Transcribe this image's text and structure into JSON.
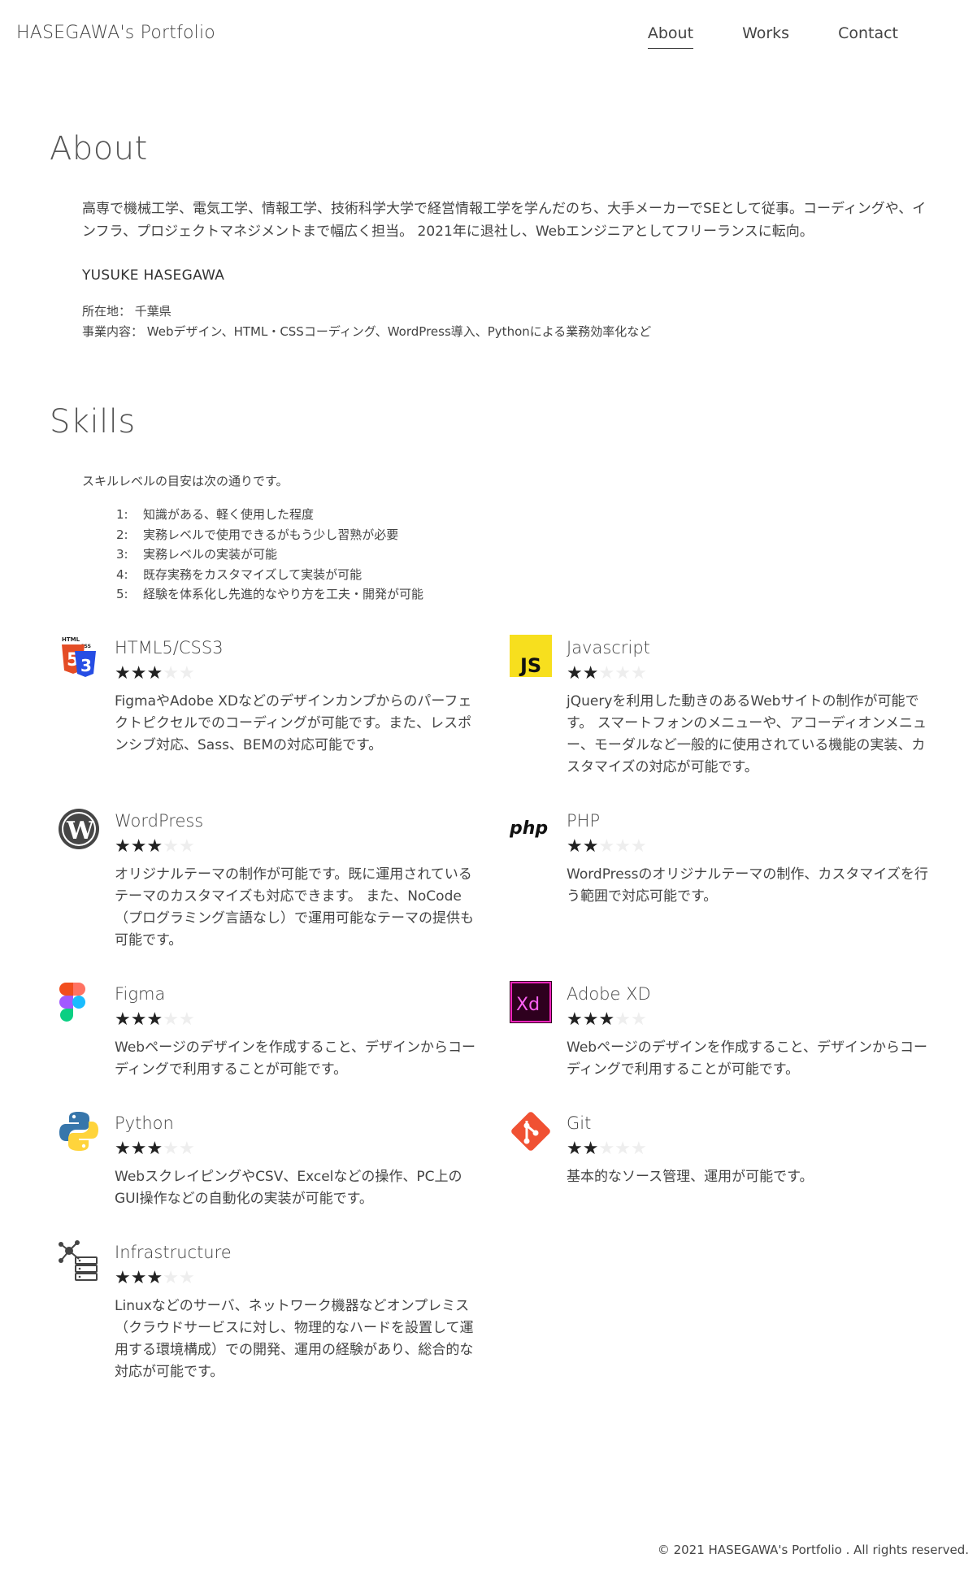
{
  "header": {
    "site_title": "HASEGAWA's Portfolio",
    "nav": [
      "About",
      "Works",
      "Contact"
    ]
  },
  "about": {
    "title": "About",
    "text": "高専で機械工学、電気工学、情報工学、技術科学大学で経営情報工学を学んだのち、大手メーカーでSEとして従事。コーディングや、インフラ、プロジェクトマネジメントまで幅広く担当。 2021年に退社し、Webエンジニアとしてフリーランスに転向。",
    "name": "YUSUKE HASEGAWA",
    "location": "所在地： 千葉県",
    "business": "事業内容： Webデザイン、HTML・CSSコーディング、WordPress導入、Pythonによる業務効率化など"
  },
  "skills": {
    "title": "Skills",
    "intro": "スキルレベルの目安は次の通りです。",
    "levels": [
      {
        "num": "1:",
        "text": "知識がある、軽く使用した程度"
      },
      {
        "num": "2:",
        "text": "実務レベルで使用できるがもう少し習熟が必要"
      },
      {
        "num": "3:",
        "text": "実務レベルの実装が可能"
      },
      {
        "num": "4:",
        "text": "既存実務をカスタマイズして実装が可能"
      },
      {
        "num": "5:",
        "text": "経験を体系化し先進的なやり方を工夫・開発が可能"
      }
    ],
    "items": [
      {
        "name": "HTML5/CSS3",
        "rating": 3,
        "icon": "html5-css3-icon",
        "desc": "FigmaやAdobe XDなどのデザインカンプからのパーフェクトピクセルでのコーディングが可能です。また、レスポンシブ対応、Sass、BEMの対応可能です。"
      },
      {
        "name": "Javascript",
        "rating": 2,
        "icon": "javascript-icon",
        "desc": "jQueryを利用した動きのあるWebサイトの制作が可能です。 スマートフォンのメニューや、アコーディオンメニュー、モーダルなど一般的に使用されている機能の実装、カスタマイズの対応が可能です。"
      },
      {
        "name": "WordPress",
        "rating": 3,
        "icon": "wordpress-icon",
        "desc": "オリジナルテーマの制作が可能です。既に運用されているテーマのカスタマイズも対応できます。 また、NoCode（プログラミング言語なし）で運用可能なテーマの提供も可能です。"
      },
      {
        "name": "PHP",
        "rating": 2,
        "icon": "php-icon",
        "desc": "WordPressのオリジナルテーマの制作、カスタマイズを行う範囲で対応可能です。"
      },
      {
        "name": "Figma",
        "rating": 3,
        "icon": "figma-icon",
        "desc": "Webページのデザインを作成すること、デザインからコーディングで利用することが可能です。"
      },
      {
        "name": "Adobe XD",
        "rating": 3,
        "icon": "adobe-xd-icon",
        "desc": "Webページのデザインを作成すること、デザインからコーディングで利用することが可能です。"
      },
      {
        "name": "Python",
        "rating": 3,
        "icon": "python-icon",
        "desc": "WebスクレイピングやCSV、Excelなどの操作、PC上のGUI操作などの自動化の実装が可能です。"
      },
      {
        "name": "Git",
        "rating": 2,
        "icon": "git-icon",
        "desc": "基本的なソース管理、運用が可能です。"
      },
      {
        "name": "Infrastructure",
        "rating": 3,
        "icon": "infrastructure-icon",
        "desc": "Linuxなどのサーバ、ネットワーク機器などオンプレミス（クラウドサービスに対し、物理的なハードを設置して運用する環境構成）での開発、運用の経験があり、総合的な対応が可能です。"
      }
    ]
  },
  "footer": {
    "copyright": "© 2021 HASEGAWA's Portfolio . All rights reserved."
  }
}
